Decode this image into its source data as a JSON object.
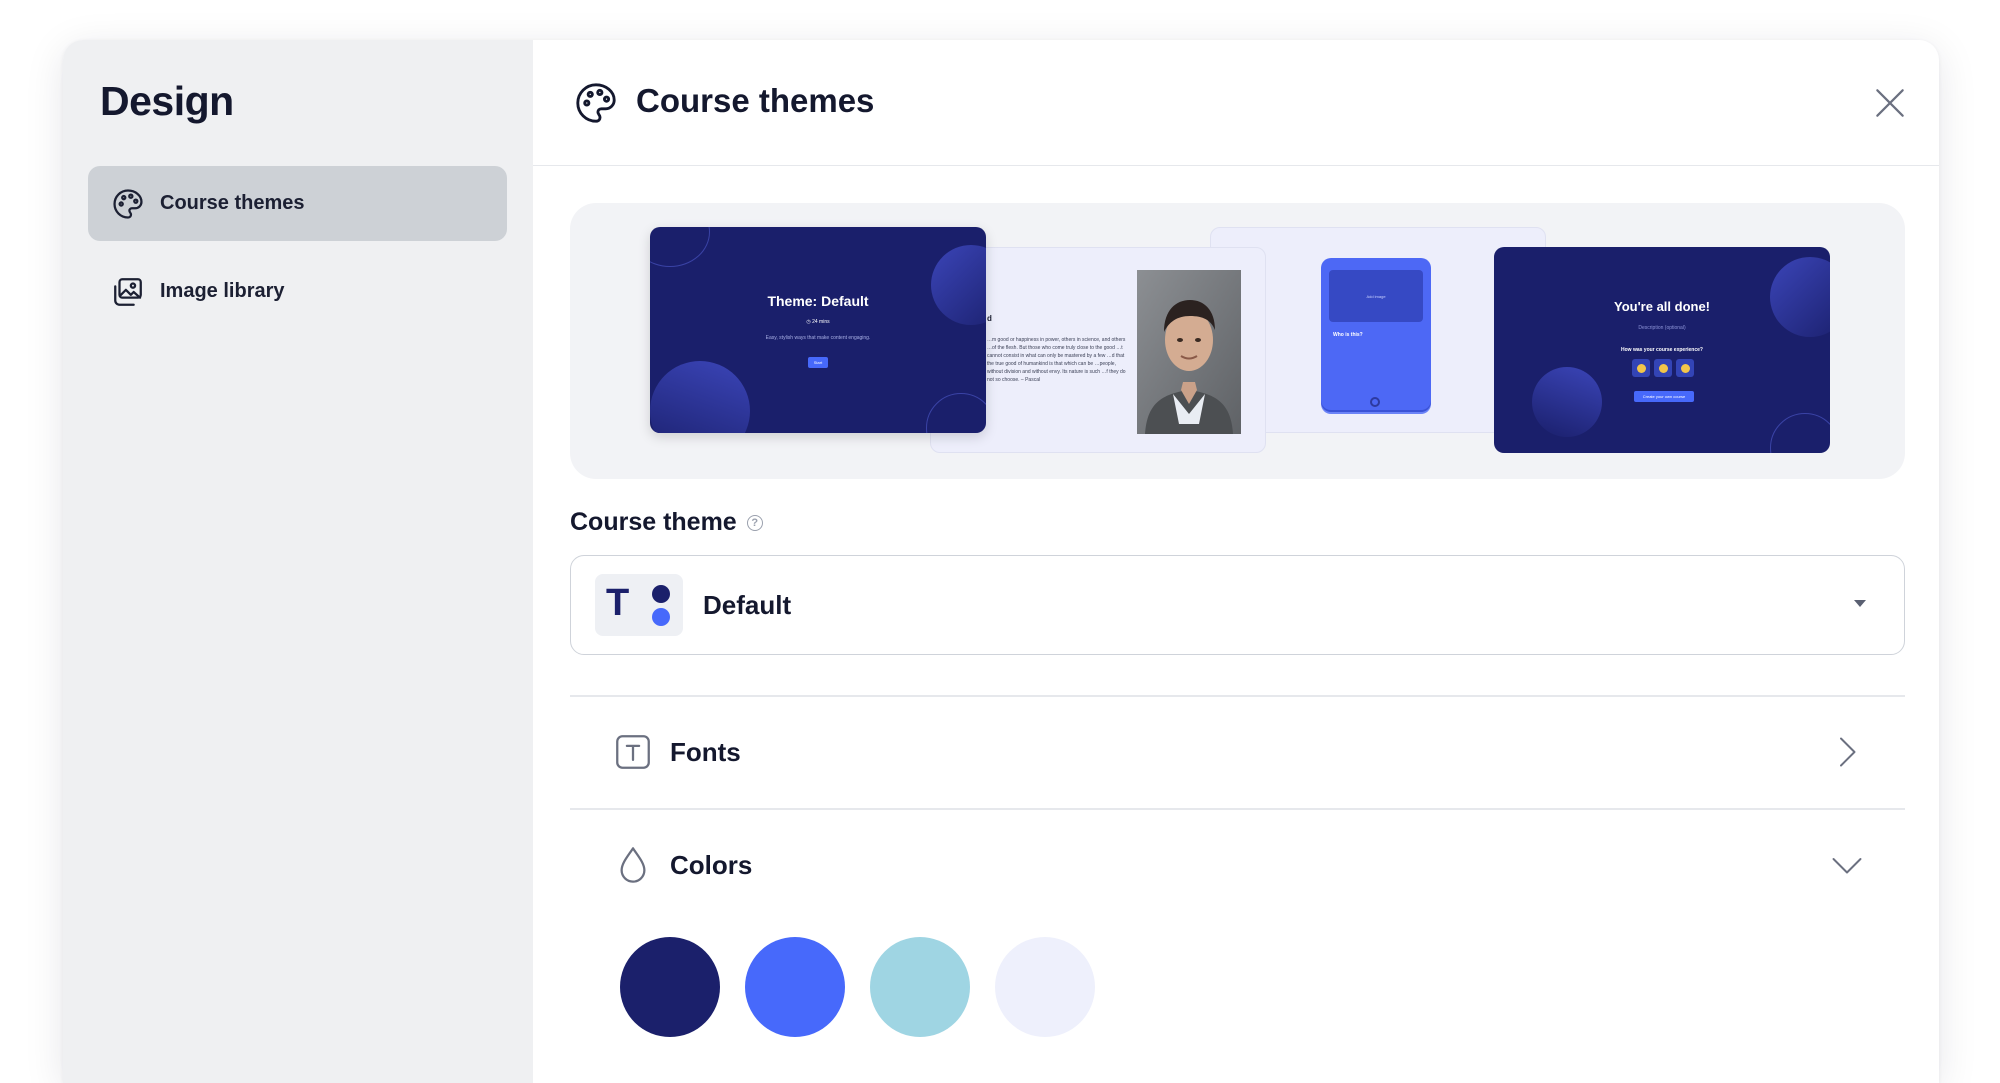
{
  "sidebar": {
    "title": "Design",
    "items": [
      {
        "label": "Course themes",
        "icon": "palette-icon",
        "active": true
      },
      {
        "label": "Image library",
        "icon": "image-library-icon",
        "active": false
      }
    ]
  },
  "header": {
    "title": "Course themes",
    "icon": "palette-icon",
    "close_icon": "close-icon"
  },
  "preview": {
    "slide1": {
      "title": "Theme: Default",
      "meta": "◷ 24 mins",
      "desc": "Easy, stylish ways that make content engaging.",
      "button": "Start"
    },
    "slide2": {
      "heading": "d",
      "quote": "…m good or happiness in power, others in science, and others …of the flesh. But those who come truly close to the good …t cannot consist in what can only be mastered by a few …d that the true good of humankind is that which can be …people, without division and without envy. Its nature is such …f they do not so choose. – Pascal"
    },
    "slide3": {
      "image_hint": "Add image",
      "question": "Who is this?"
    },
    "slide4": {
      "title": "You're all done!",
      "desc": "Description (optional)",
      "question": "How was your course experience?",
      "emojis": [
        "😐",
        "😐",
        "😐"
      ],
      "button": "Create your own course"
    }
  },
  "course_theme": {
    "label": "Course theme",
    "help_icon": "help-icon",
    "selected": "Default",
    "badge_letter": "T",
    "badge_colors": [
      "#1b206b",
      "#4769fb"
    ]
  },
  "sections": [
    {
      "label": "Fonts",
      "icon": "font-icon",
      "state": "collapsed"
    },
    {
      "label": "Colors",
      "icon": "droplet-icon",
      "state": "expanded"
    }
  ],
  "colors": [
    "#1b206b",
    "#4769fb",
    "#9fd5e3",
    "#eef0fc"
  ]
}
